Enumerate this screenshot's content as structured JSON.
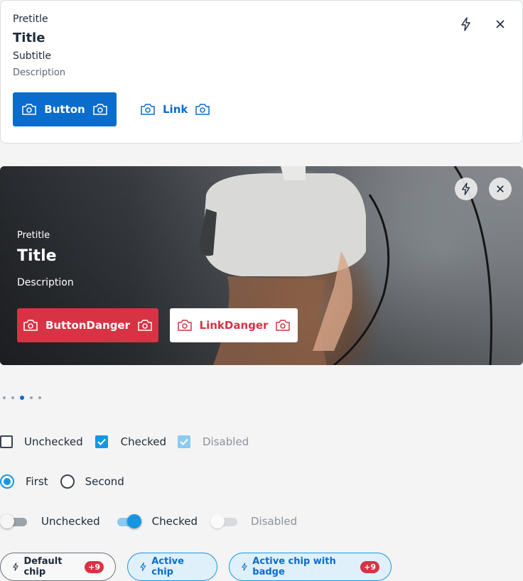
{
  "card_light": {
    "pretitle": "Pretitle",
    "title": "Title",
    "subtitle": "Subtitle",
    "description": "Description",
    "primary_button": "Button",
    "link": "Link",
    "action_icon": "lightning-icon",
    "close_icon": "close-icon"
  },
  "card_image": {
    "pretitle": "Pretitle",
    "title": "Title",
    "description": "Description",
    "danger_button": "ButtonDanger",
    "danger_link": "LinkDanger",
    "action_icon": "lightning-icon",
    "close_icon": "close-icon"
  },
  "pagination": {
    "count": 5,
    "active_index": 2
  },
  "checkboxes": [
    {
      "label": "Unchecked",
      "state": "unchecked"
    },
    {
      "label": "Checked",
      "state": "checked"
    },
    {
      "label": "Disabled",
      "state": "disabled-checked"
    }
  ],
  "radios": [
    {
      "label": "First",
      "checked": true
    },
    {
      "label": "Second",
      "checked": false
    }
  ],
  "switches": [
    {
      "label": "Unchecked",
      "state": "off"
    },
    {
      "label": "Checked",
      "state": "on"
    },
    {
      "label": "Disabled",
      "state": "disabled"
    }
  ],
  "chips": [
    {
      "label": "Default chip",
      "badge": "+9",
      "active": false
    },
    {
      "label": "Active chip",
      "badge": "",
      "active": true
    },
    {
      "label": "Active chip with badge",
      "badge": "+9",
      "active": true
    }
  ],
  "colors": {
    "primary": "#0a6ccd",
    "danger": "#d83344",
    "accent": "#1696e2"
  }
}
